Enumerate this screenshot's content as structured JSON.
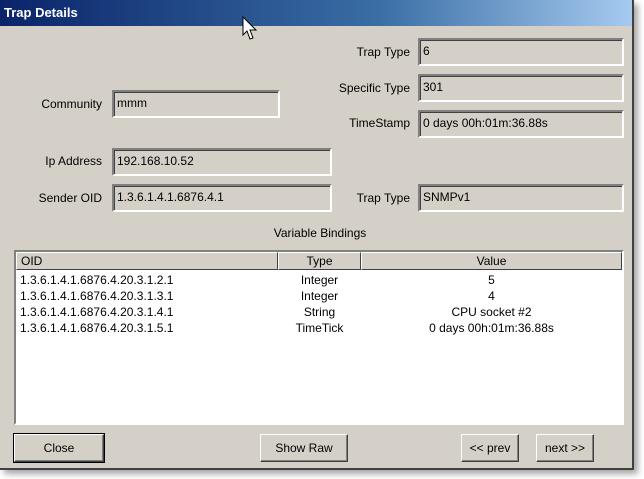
{
  "window": {
    "title": "Trap Details"
  },
  "fields": {
    "trap_type_label": "Trap Type",
    "trap_type": "6",
    "specific_type_label": "Specific Type",
    "specific_type": "301",
    "timestamp_label": "TimeStamp",
    "timestamp": "0 days 00h:01m:36.88s",
    "community_label": "Community",
    "community": "mmm",
    "ip_label": "Ip Address",
    "ip": "192.168.10.52",
    "sender_oid_label": "Sender OID",
    "sender_oid": "1.3.6.1.4.1.6876.4.1",
    "trap_version_label": "Trap Type",
    "trap_version": "SNMPv1"
  },
  "bindings": {
    "title": "Variable Bindings",
    "columns": [
      "OID",
      "Type",
      "Value"
    ],
    "rows": [
      [
        "1.3.6.1.4.1.6876.4.20.3.1.2.1",
        "Integer",
        "5"
      ],
      [
        "1.3.6.1.4.1.6876.4.20.3.1.3.1",
        "Integer",
        "4"
      ],
      [
        "1.3.6.1.4.1.6876.4.20.3.1.4.1",
        "String",
        "CPU socket #2"
      ],
      [
        "1.3.6.1.4.1.6876.4.20.3.1.5.1",
        "TimeTick",
        "0 days 00h:01m:36.88s"
      ]
    ]
  },
  "buttons": {
    "close": "Close",
    "show_raw": "Show Raw",
    "prev": "<< prev",
    "next": "next >>"
  }
}
